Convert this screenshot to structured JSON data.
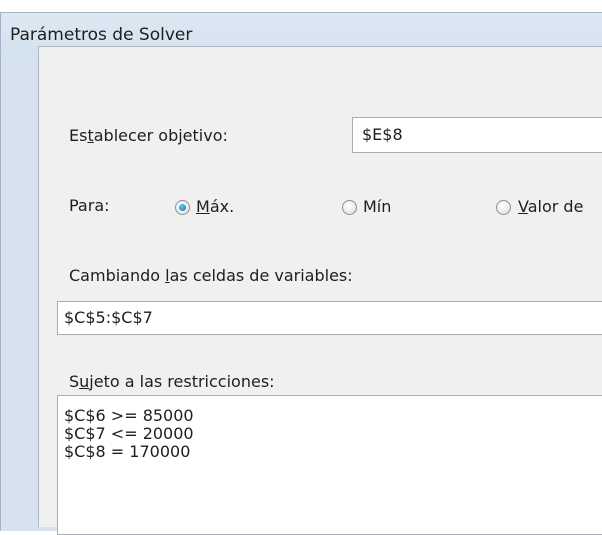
{
  "window": {
    "title": "Parámetros de Solver"
  },
  "objective": {
    "label_pre": "Es",
    "label_u": "t",
    "label_post": "ablecer objetivo:",
    "value": "$E$8"
  },
  "to": {
    "label": "Para:",
    "options": [
      {
        "u": "M",
        "rest": "áx.",
        "selected": true
      },
      {
        "u": "",
        "rest": "Mín",
        "selected": false
      },
      {
        "u": "V",
        "rest": "alor de",
        "selected": false
      }
    ]
  },
  "variables": {
    "label_pre": "Cambiando ",
    "label_u": "l",
    "label_post": "as celdas de variables:",
    "value": "$C$5:$C$7"
  },
  "constraints": {
    "label_pre": "S",
    "label_u": "u",
    "label_post": "jeto a las restricciones:",
    "items": [
      "$C$6 >= 85000",
      "$C$7 <= 20000",
      "$C$8 = 170000"
    ]
  }
}
